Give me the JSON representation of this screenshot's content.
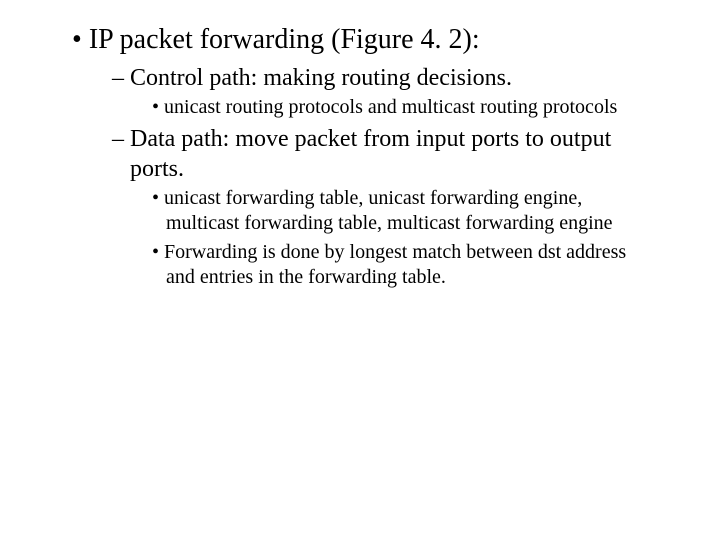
{
  "slide": {
    "l1_a": "IP packet forwarding (Figure 4. 2):",
    "l2_a": "Control path: making routing decisions.",
    "l3_a": "unicast routing protocols and multicast routing protocols",
    "l2_b": "Data path: move packet from input ports to output ports.",
    "l3_b": "unicast forwarding table, unicast forwarding engine, multicast forwarding table, multicast forwarding engine",
    "l3_c": "Forwarding is done by longest match between dst address and entries in the forwarding table."
  }
}
